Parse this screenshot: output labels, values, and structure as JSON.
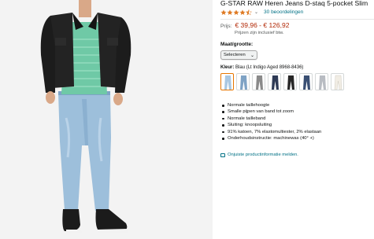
{
  "product": {
    "title": "G-STAR RAW Heren Jeans D-staq 5-pocket Slim",
    "rating_stars": 4.5,
    "reviews_label": "30 beoordelingen",
    "price_label": "Prijs:",
    "price_range": "€ 39,96 - € 126,92",
    "tax_note": "Prijzen zijn inclusief btw."
  },
  "size": {
    "label": "Maat/grootte:",
    "select_value": "Selecteren"
  },
  "color": {
    "label": "Kleur:",
    "selected_value": "Blau (Lt Indigo Aged 8968-8436)",
    "swatch_icons": [
      "light-blue-jeans",
      "medium-blue-jeans",
      "grey-jeans",
      "dark-indigo-jeans",
      "black-jeans",
      "dark-blue-jeans",
      "light-grey-jeans",
      "white-jeans"
    ]
  },
  "features": [
    "Normale taillehoogte",
    "Smalle pijpen van band tot zoom",
    "Normale tailleband",
    "Sluiting: knoopsluiting",
    "91% katoen, 7% elastomultiester, 2% elastaan",
    "Onderhoudsinstructie: machinewas (40° +)"
  ],
  "report_link": "Onjuiste productinformatie melden.",
  "colors": {
    "price": "#b12704",
    "link": "#007185",
    "star": "#de7921",
    "selected_border": "#e77600"
  }
}
